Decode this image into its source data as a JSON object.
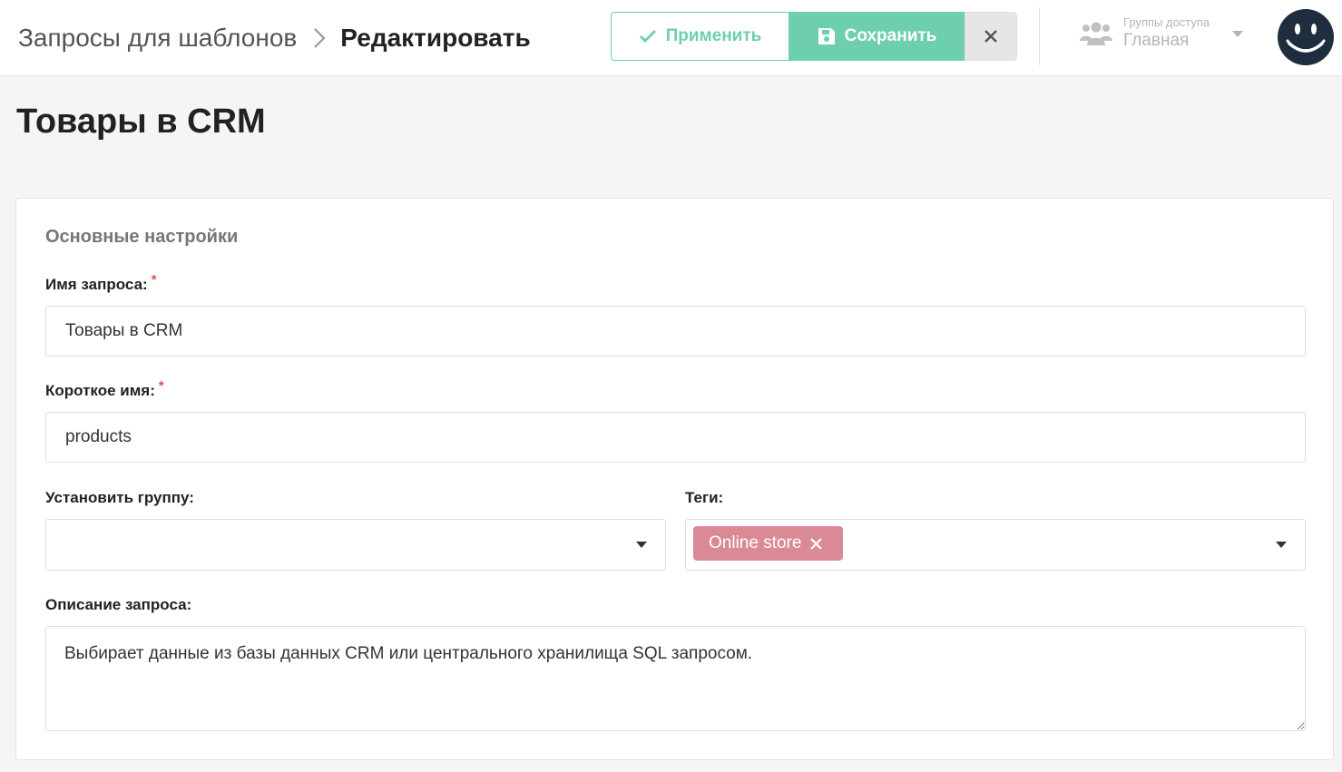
{
  "header": {
    "breadcrumb_parent": "Запросы для шаблонов",
    "breadcrumb_current": "Редактировать",
    "apply_label": "Применить",
    "save_label": "Сохранить",
    "access_groups_label": "Группы доступа",
    "access_groups_value": "Главная"
  },
  "page": {
    "title": "Товары в CRM"
  },
  "form": {
    "section_title": "Основные настройки",
    "name_label": "Имя запроса:",
    "name_value": "Товары в CRM",
    "short_name_label": "Короткое имя:",
    "short_name_value": "products",
    "group_label": "Установить группу:",
    "group_value": "",
    "tags_label": "Теги:",
    "tags": [
      "Online store"
    ],
    "description_label": "Описание запроса:",
    "description_value": "Выбирает данные из базы данных CRM или центрального хранилища SQL запросом.",
    "required_mark": "*"
  },
  "colors": {
    "accent": "#6ecfb0",
    "tag": "#da8a95",
    "avatar": "#1e2e3e",
    "required": "#d9534f"
  },
  "icons": {
    "breadcrumb_separator": "chevron-right-icon",
    "apply": "check-icon",
    "save": "floppy-disk-icon",
    "close": "close-icon",
    "access_groups": "users-icon",
    "dropdown": "caret-down-icon",
    "avatar": "smiley-face-icon",
    "tag_remove": "close-icon"
  }
}
